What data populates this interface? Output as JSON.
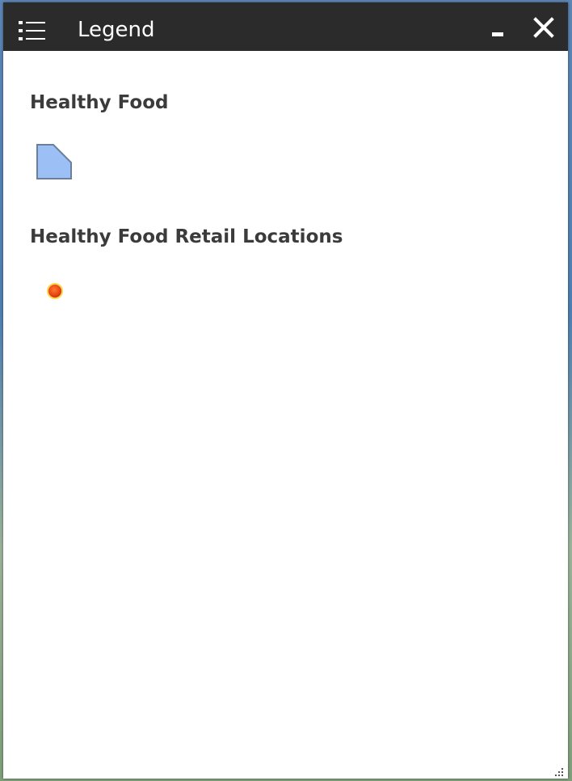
{
  "window": {
    "title": "Legend",
    "icons": {
      "menu": "list-menu-icon",
      "minimize": "minimize-icon",
      "close": "close-icon",
      "resize": "resize-grip-icon"
    }
  },
  "layers": [
    {
      "title": "Healthy Food",
      "symbol": "polygon",
      "fill_color": "#9cc0f5",
      "stroke_color": "#6a7f99"
    },
    {
      "title": "Healthy Food Retail Locations",
      "symbol": "point",
      "fill_color": "#e8451a",
      "stroke_color": "#ffd54a"
    }
  ],
  "colors": {
    "titlebar": "#2b2b2b",
    "panel": "#ffffff",
    "text": "#3b3b3b"
  }
}
